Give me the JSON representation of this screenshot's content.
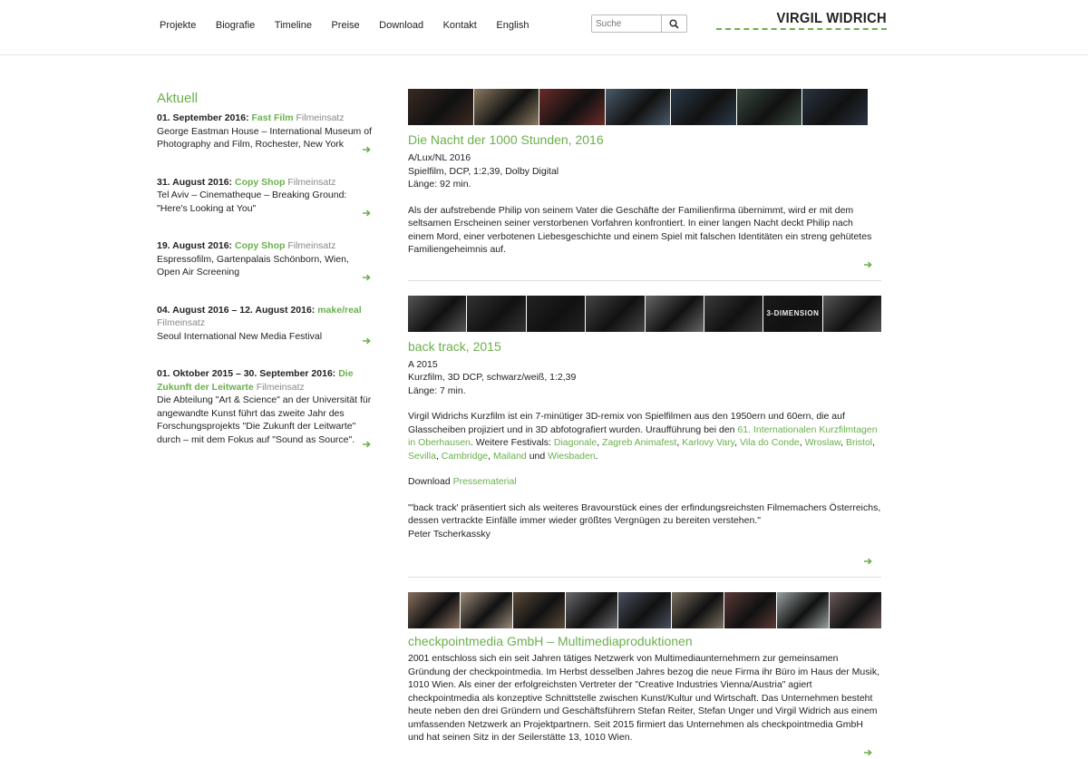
{
  "header": {
    "nav": [
      "Projekte",
      "Biografie",
      "Timeline",
      "Preise",
      "Download",
      "Kontakt",
      "English"
    ],
    "search_placeholder": "Suche",
    "logo_text": "VIRGIL WIDRICH",
    "search_icon": "magnifier-icon"
  },
  "sidebar": {
    "heading": "Aktuell",
    "items": [
      {
        "date": "01. September 2016:",
        "link": "Fast Film",
        "tag": "Filmeinsatz",
        "text": "George Eastman House – International Museum of Photography and Film, Rochester, New York"
      },
      {
        "date": "31. August 2016:",
        "link": "Copy Shop",
        "tag": "Filmeinsatz",
        "text": "Tel Aviv – Cinematheque – Breaking Ground: \"Here's Looking at You\""
      },
      {
        "date": "19. August 2016:",
        "link": "Copy Shop",
        "tag": "Filmeinsatz",
        "text": "Espressofilm, Gartenpalais Schönborn, Wien, Open Air Screening"
      },
      {
        "date": "04. August 2016 – 12. August 2016:",
        "link": "make/real",
        "tag": "Filmeinsatz",
        "text": "Seoul International New Media Festival"
      },
      {
        "date": "01. Oktober 2015 – 30. September 2016:",
        "link": "Die Zukunft der Leitwarte",
        "tag": "Filmeinsatz",
        "text": "Die Abteilung \"Art & Science\" an der Universität für angewandte Kunst führt das zweite Jahr des Forschungsprojekts \"Die Zukunft der Leitwarte\" durch – mit dem Fokus auf \"Sound as Source\"."
      }
    ]
  },
  "projects": [
    {
      "title": "Die Nacht der 1000 Stunden, 2016",
      "meta": [
        "A/Lux/NL 2016",
        "Spielfilm, DCP, 1:2,39, Dolby Digital",
        "Länge: 92 min."
      ],
      "description": "Als der aufstrebende Philip von seinem Vater die Geschäfte der Familienfirma übernimmt, wird er mit dem seltsamen Erscheinen seiner verstorbenen Vorfahren konfrontiert. In einer langen Nacht deckt Philip nach einem Mord, einer verbotenen Liebesgeschichte und einem Spiel mit falschen Identitäten ein streng gehütetes Familiengeheimnis auf.",
      "frames": [
        "#3a2a22",
        "#8a7a60",
        "#6a2a28",
        "#4a5a6a",
        "#2c3a4a",
        "#3a4a40",
        "#2a3440"
      ]
    },
    {
      "title": "back track, 2015",
      "meta": [
        "A 2015",
        "Kurzfilm, 3D DCP, schwarz/weiß, 1:2,39",
        "Länge: 7 min."
      ],
      "desc_before": "Virgil Widrichs Kurzfilm ist ein 7-minütiger 3D-remix von Spielfilmen aus den 1950ern und 60ern, die auf Glasscheiben projiziert und in 3D abfotografiert wurden. Uraufführung bei den ",
      "desc_link": "61. Internationalen Kurzfilmtagen in Oberhausen",
      "desc_mid": ". Weitere Festivals: ",
      "festivals": [
        "Diagonale",
        "Zagreb Animafest",
        "Karlovy Vary",
        "Vila do Conde",
        "Wroslaw",
        "Bristol",
        "Sevilla",
        "Cambridge",
        "Mailand",
        "Wiesbaden"
      ],
      "and_word": "und",
      "download_label": "Download",
      "download_link": "Pressematerial",
      "quote": "\"'back track' präsentiert sich als weiteres Bravourstück eines der erfindungsreichsten Filmemachers Österreichs, dessen vertrackte Einfälle immer wieder größtes Vergnügen zu bereiten verstehen.\"",
      "quote_author": "Peter Tscherkassky",
      "frames": [
        "#555",
        "#333",
        "#222",
        "#444",
        "#666",
        "#3a3a3a",
        "#1a1a1a",
        "#555"
      ],
      "frame_text": "3-DIMENSION"
    },
    {
      "title": "checkpointmedia GmbH – Multimediaproduktionen",
      "description": "2001 entschloss sich ein seit Jahren tätiges Netzwerk von Multimediaunternehmern zur gemeinsamen Gründung der checkpointmedia. Im Herbst desselben Jahres bezog die neue Firma ihr Büro im Haus der Musik, 1010 Wien. Als einer der erfolgreichsten Vertreter der \"Creative Industries Vienna/Austria\" agiert checkpointmedia als konzeptive Schnittstelle zwischen Kunst/Kultur und Wirtschaft. Das Unternehmen besteht heute neben den drei Gründern und Geschäftsführern Stefan Reiter, Stefan Unger und Virgil Widrich aus einem umfassenden Netzwerk an Projektpartnern. Seit 2015 firmiert das Unternehmen als checkpointmedia GmbH und hat seinen Sitz in der Seilerstätte 13, 1010 Wien.",
      "frames": [
        "#8a7060",
        "#9a8a7a",
        "#5a4a3a",
        "#6a6a70",
        "#4a5060",
        "#7a7060",
        "#5a3a38",
        "#9aa0a0",
        "#6a5a58"
      ]
    }
  ]
}
